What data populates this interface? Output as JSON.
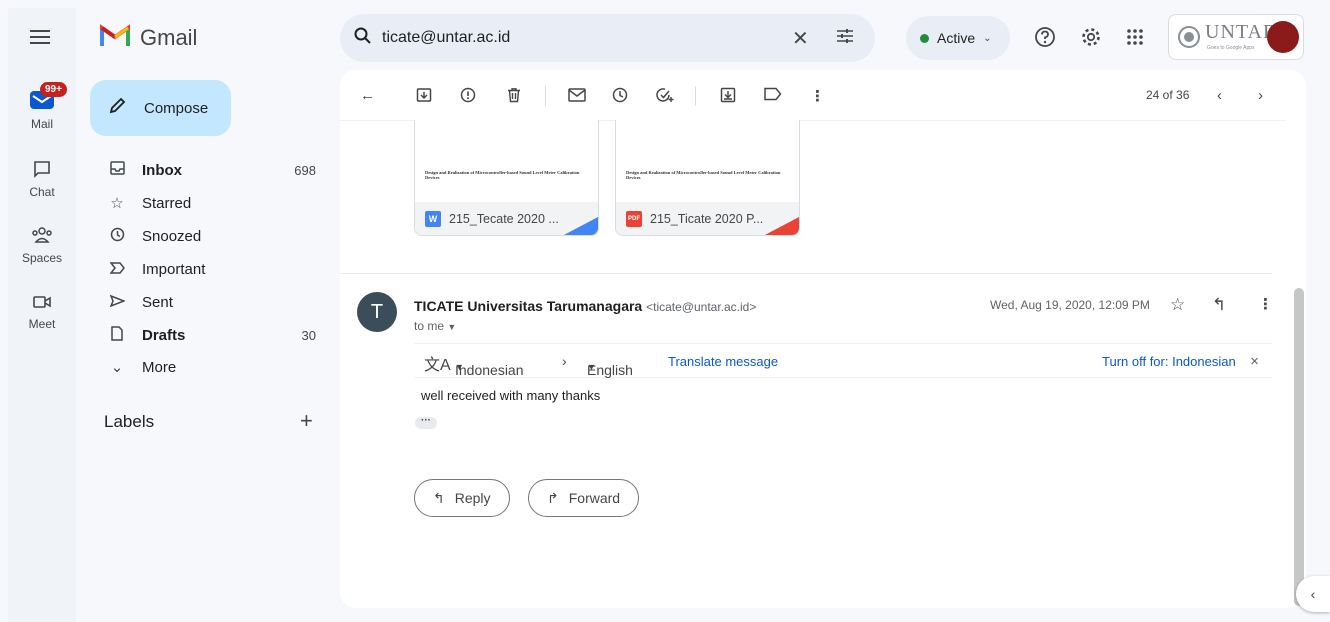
{
  "app": {
    "name": "Gmail"
  },
  "rail": {
    "mail": {
      "label": "Mail",
      "badge": "99+"
    },
    "chat": {
      "label": "Chat"
    },
    "spaces": {
      "label": "Spaces"
    },
    "meet": {
      "label": "Meet"
    }
  },
  "compose": {
    "label": "Compose"
  },
  "nav": [
    {
      "label": "Inbox",
      "count": "698",
      "icon": "inbox-icon"
    },
    {
      "label": "Starred",
      "count": "",
      "icon": "star-icon"
    },
    {
      "label": "Snoozed",
      "count": "",
      "icon": "clock-icon"
    },
    {
      "label": "Important",
      "count": "",
      "icon": "important-icon"
    },
    {
      "label": "Sent",
      "count": "",
      "icon": "send-icon"
    },
    {
      "label": "Drafts",
      "count": "30",
      "icon": "draft-icon"
    },
    {
      "label": "More",
      "count": "",
      "icon": "chevron-down-icon"
    }
  ],
  "labels": {
    "title": "Labels"
  },
  "search": {
    "value": "ticate@untar.ac.id"
  },
  "status": {
    "label": "Active",
    "color": "#1e8e3e"
  },
  "brand": {
    "text": "UNTAR",
    "subtext": "Goes to Google Apps"
  },
  "pager": {
    "text": "24 of 36"
  },
  "attachments": [
    {
      "name": "215_Tecate 2020 ...",
      "type": "W",
      "color": "#4285f4",
      "doc_title": "Design and Realization of Microcontroller-based Sound Level Meter Calibration Devices"
    },
    {
      "name": "215_Ticate 2020 P...",
      "type": "PDF",
      "color": "#ea4335",
      "doc_title": "Design and Realization of Microcontroller-based Sound Level Meter Calibration Devices"
    }
  ],
  "message": {
    "avatar_letter": "T",
    "sender_name": "TICATE Universitas Tarumanagara",
    "sender_email": "<ticate@untar.ac.id>",
    "to": "to me",
    "date": "Wed, Aug 19, 2020, 12:09 PM",
    "body": "well received with many thanks"
  },
  "translate": {
    "from": "Indonesian",
    "to": "English",
    "action": "Translate message",
    "turn_off": "Turn off for: Indonesian"
  },
  "actions": {
    "reply": "Reply",
    "forward": "Forward"
  }
}
